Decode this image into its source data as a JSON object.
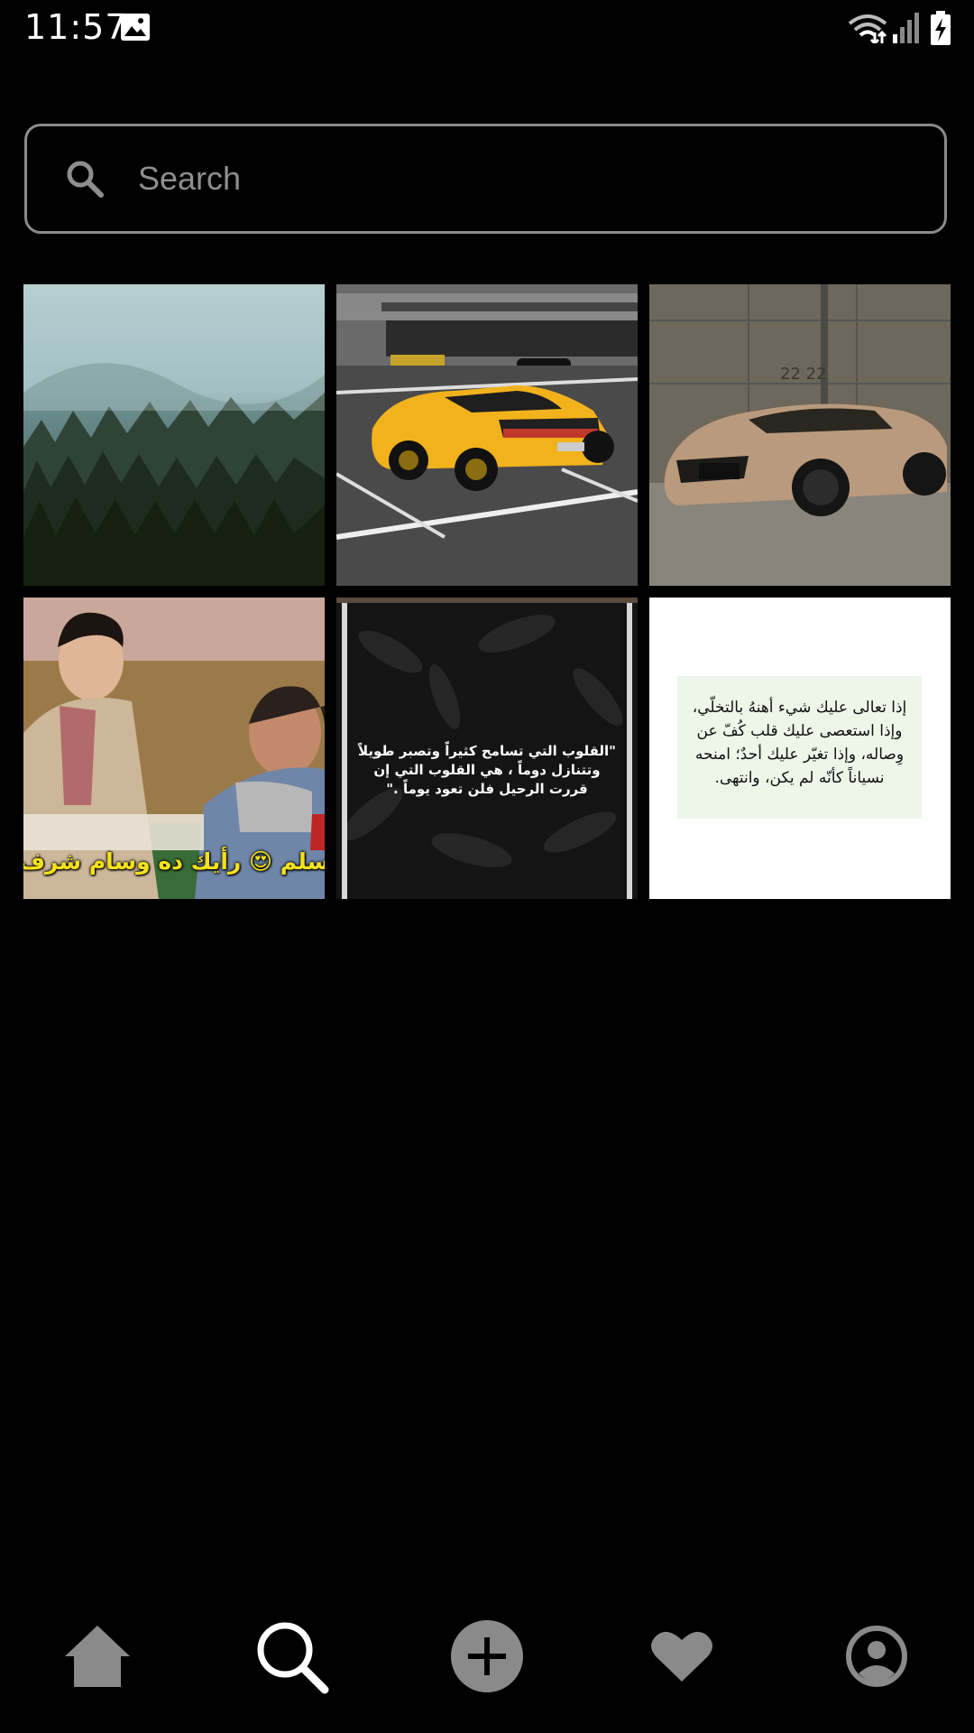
{
  "status_bar": {
    "time": "11:57",
    "icons": [
      "gallery-icon",
      "wifi-icon",
      "signal-icon",
      "battery-charging-icon"
    ]
  },
  "search": {
    "placeholder": "Search",
    "value": "",
    "icon": "search-icon"
  },
  "grid": {
    "tiles": [
      {
        "kind": "photo",
        "subject": "misty pine forest"
      },
      {
        "kind": "photo",
        "subject": "yellow sports car in parking lot"
      },
      {
        "kind": "photo",
        "subject": "gold sedan in front of concrete wall"
      },
      {
        "kind": "photo",
        "subject": "two men sitting, movie still",
        "caption": "سلم 😍 رأيك ده وسام شرف افت"
      },
      {
        "kind": "quote",
        "subject": "dark leaves background",
        "caption": "\"القلوب التي تسامح كثيراً وتصبر طويلاً وتتنازل دوماً ، هي القلوب التي إن قررت الرحيل فلن تعود يوماً .\""
      },
      {
        "kind": "quote",
        "subject": "white card with arabic text",
        "caption": "إذا تعالى عليك شيء أهنهُ بالتخلّي، وإذا استعصى عليك قلب كُفّ عن وِصاله، وإذا تغيّر عليك أحدٌ؛ امنحه نسياناً كأنّه لم يكن، وانتهى."
      }
    ]
  },
  "bottom_nav": {
    "items": [
      {
        "name": "home",
        "icon": "home-icon",
        "active": false
      },
      {
        "name": "search",
        "icon": "search-icon",
        "active": true
      },
      {
        "name": "add",
        "icon": "add-icon",
        "active": false
      },
      {
        "name": "favorites",
        "icon": "heart-icon",
        "active": false
      },
      {
        "name": "profile",
        "icon": "profile-icon",
        "active": false
      }
    ]
  },
  "colors": {
    "background": "#000000",
    "border": "#8a8a8a",
    "inactive_icon": "#8a8a8a",
    "active_icon": "#ffffff"
  }
}
